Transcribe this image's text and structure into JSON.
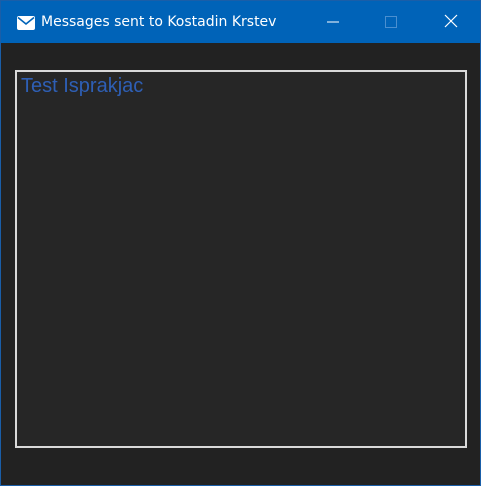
{
  "window": {
    "title": "Messages sent to Kostadin Krstev",
    "icon": "envelope-icon",
    "controls": [
      "minimize-icon",
      "maximize-icon",
      "close-icon"
    ],
    "titlebar_color": "#0063b8",
    "background_color": "#222222"
  },
  "messages": {
    "items": [
      "Test Isprakjac"
    ],
    "text_color": "#2e5fb5",
    "border_color": "#d9d9d9"
  }
}
